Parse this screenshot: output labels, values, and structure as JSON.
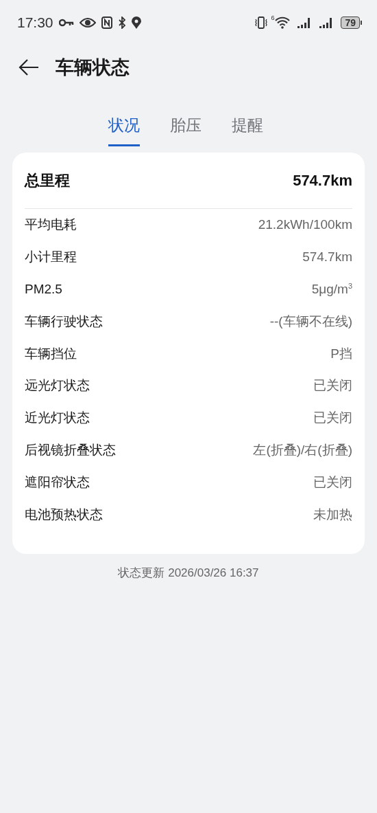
{
  "status_bar": {
    "time": "17:30",
    "wifi_label": "6",
    "battery": "79"
  },
  "header": {
    "title": "车辆状态"
  },
  "tabs": [
    {
      "label": "状况",
      "selected": true
    },
    {
      "label": "胎压",
      "selected": false
    },
    {
      "label": "提醒",
      "selected": false
    }
  ],
  "summary": {
    "label": "总里程",
    "value": "574.7km"
  },
  "rows": [
    {
      "label": "平均电耗",
      "value": "21.2kWh/100km"
    },
    {
      "label": "小计里程",
      "value": "574.7km"
    },
    {
      "label": "PM2.5",
      "value": "5μg/m$^{3}$"
    },
    {
      "label": "车辆行驶状态",
      "value": "--(车辆不在线)"
    },
    {
      "label": "车辆挡位",
      "value": "P挡"
    },
    {
      "label": "远光灯状态",
      "value": "已关闭"
    },
    {
      "label": "近光灯状态",
      "value": "已关闭"
    },
    {
      "label": "后视镜折叠状态",
      "value": "左(折叠)/右(折叠)"
    },
    {
      "label": "遮阳帘状态",
      "value": "已关闭"
    },
    {
      "label": "电池预热状态",
      "value": "未加热"
    }
  ],
  "footer": {
    "update_text": "状态更新 2026/03/26 16:37"
  }
}
